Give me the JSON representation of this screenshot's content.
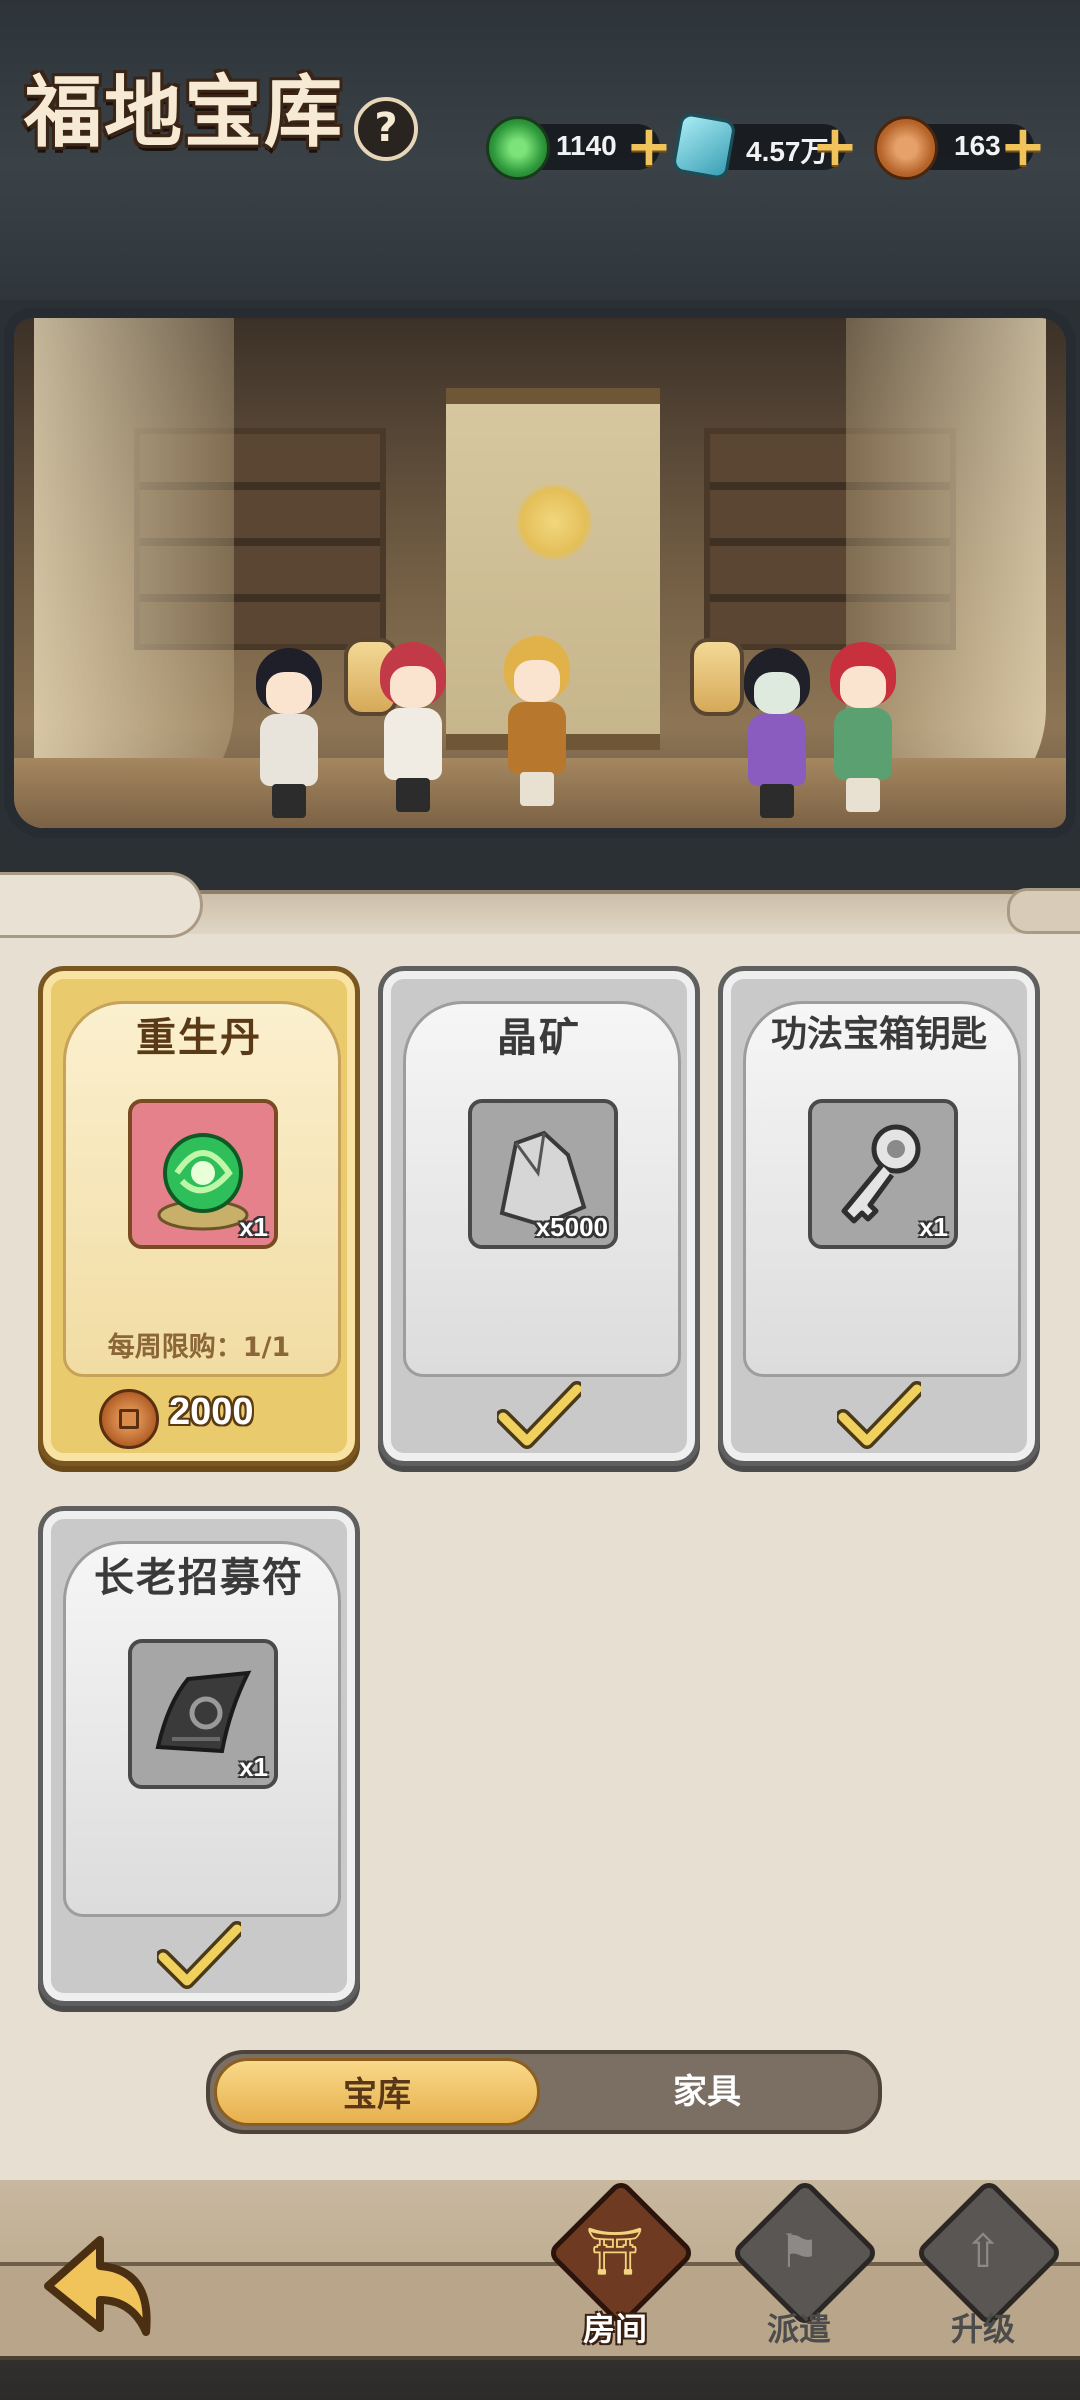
{
  "header": {
    "title": "福地宝库",
    "help": "?"
  },
  "resources": [
    {
      "icon": "jade-token-icon",
      "value": "1140",
      "color": "#3fae4a"
    },
    {
      "icon": "crystal-gem-icon",
      "value": "4.57万",
      "color": "#4ab3c4"
    },
    {
      "icon": "copper-coin-icon",
      "value": "163",
      "color": "#c9773a"
    }
  ],
  "cards": [
    {
      "name": "重生丹",
      "qty": "x1",
      "limit": "每周限购：1/1",
      "price": "2000",
      "state": "available",
      "icon": "rebirth-pill-icon"
    },
    {
      "name": "晶矿",
      "qty": "x5000",
      "state": "purchased",
      "icon": "crystal-ore-icon"
    },
    {
      "name": "功法宝箱钥匙",
      "qty": "x1",
      "state": "purchased",
      "icon": "treasure-key-icon"
    },
    {
      "name": "长老招募符",
      "qty": "x1",
      "state": "purchased",
      "icon": "recruit-talisman-icon"
    }
  ],
  "tabs": [
    {
      "label": "宝库",
      "active": true
    },
    {
      "label": "家具",
      "active": false
    }
  ],
  "bottom_nav": [
    {
      "label": "房间",
      "active": true,
      "icon": "room-icon"
    },
    {
      "label": "派遣",
      "active": false,
      "icon": "dispatch-flag-icon"
    },
    {
      "label": "升级",
      "active": false,
      "icon": "upgrade-arrow-icon"
    }
  ],
  "colors": {
    "accent_gold": "#e9ca6c",
    "panel_bg": "#e7dfd2",
    "check_gold": "#f0d15e"
  }
}
